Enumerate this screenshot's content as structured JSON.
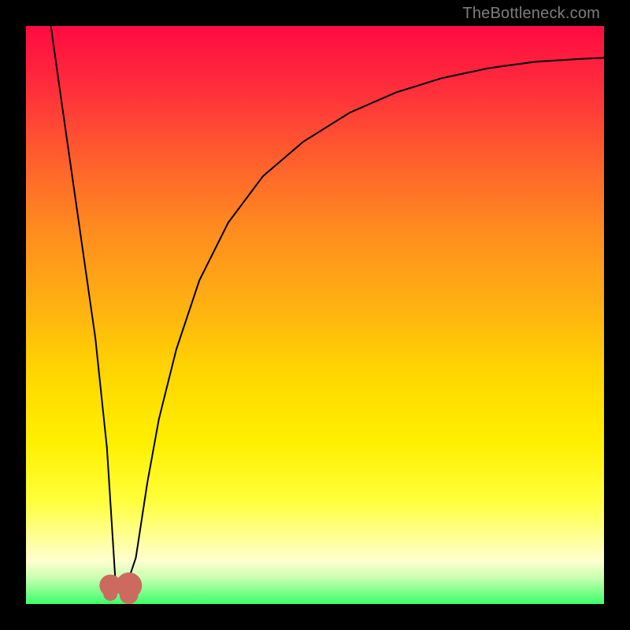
{
  "watermark": "TheBottleneck.com",
  "colors": {
    "frame": "#000000",
    "curve": "#000000",
    "marker": "#cc6a60",
    "gradient_top": "#ff0b42",
    "gradient_bottom": "#3cff6a"
  },
  "chart_data": {
    "type": "line",
    "title": "",
    "xlabel": "",
    "ylabel": "",
    "xlim": [
      0,
      100
    ],
    "ylim": [
      0,
      100
    ],
    "grid": false,
    "legend": false,
    "note": "Axes have no numeric tick labels in the source image; values below are estimates on a 0–100 scale read from pixel positions.",
    "series": [
      {
        "name": "bottleneck-curve",
        "x": [
          4.3,
          6,
          8,
          10,
          12,
          14,
          15.5,
          17.5,
          19,
          21,
          23,
          26,
          30,
          35,
          41,
          48,
          56,
          64,
          72,
          80,
          88,
          96,
          100
        ],
        "y": [
          100,
          88,
          74,
          60,
          46,
          27,
          3.5,
          3.5,
          8,
          21,
          32,
          44,
          56,
          66,
          74,
          80,
          85,
          88.5,
          91,
          92.7,
          93.8,
          94.3,
          94.5
        ]
      }
    ],
    "markers": [
      {
        "name": "optimal-start",
        "x": 14.6,
        "y": 3.2,
        "r": 1.2
      },
      {
        "name": "optimal-end",
        "x": 17.8,
        "y": 3.2,
        "r": 1.6
      }
    ],
    "optimal_region": {
      "x_start": 14.6,
      "x_end": 17.8,
      "y": 3.0
    }
  }
}
